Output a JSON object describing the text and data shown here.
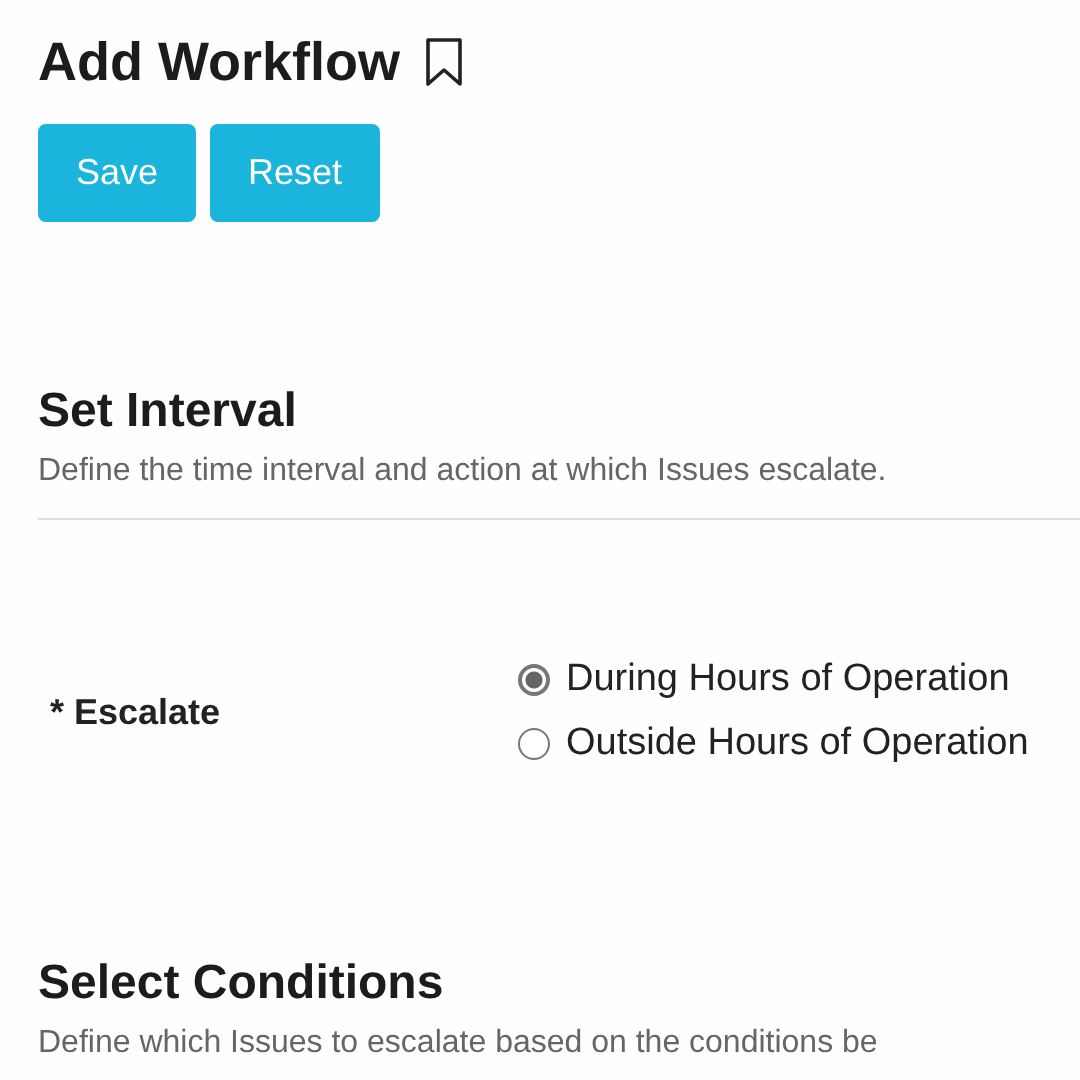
{
  "page": {
    "title": "Add Workflow"
  },
  "buttons": [
    {
      "label": "Save"
    },
    {
      "label": "Reset"
    }
  ],
  "sections": [
    {
      "heading": "Set Interval",
      "description": "Define the time interval and action at which Issues escalate.",
      "divider": true,
      "fields": [
        {
          "label": "* Escalate",
          "options": [
            {
              "label": "During Hours of Operation",
              "selected": true
            },
            {
              "label": "Outside Hours of Operation",
              "selected": false
            }
          ]
        }
      ]
    },
    {
      "heading": "Select Conditions",
      "description": "Define which Issues to escalate based on the conditions be"
    }
  ]
}
